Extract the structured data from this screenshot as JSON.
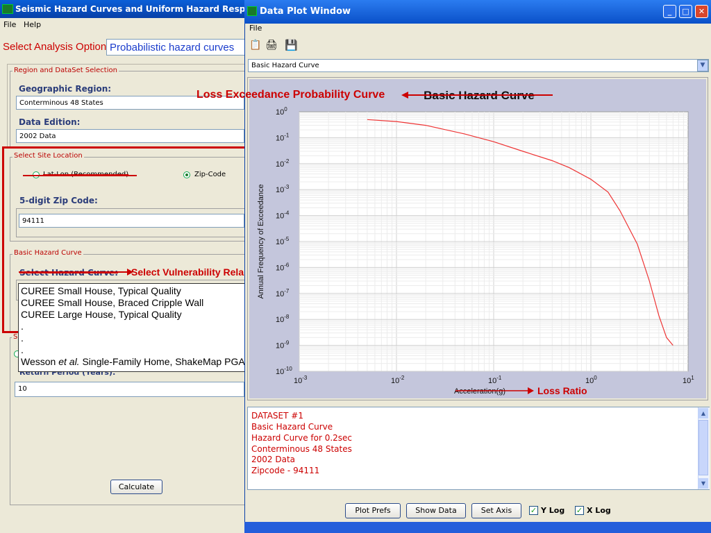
{
  "left_window": {
    "title": "Seismic Hazard Curves and Uniform Hazard Response",
    "menu": [
      "File",
      "Help"
    ],
    "analysis_label": "Select Analysis Option:",
    "analysis_value": "Probabilistic hazard curves",
    "region_group": {
      "title": "Region and DataSet Selection",
      "geo_label": "Geographic Region:",
      "geo_value": "Conterminous 48 States",
      "edition_label": "Data Edition:",
      "edition_value": "2002 Data"
    },
    "site_group": {
      "title": "Select Site Location",
      "latlon_label": "Lat-Lon (Recommended)",
      "zip_option": "Zip-Code",
      "zip_label": "5-digit Zip Code:",
      "zip_value": "94111"
    },
    "hazard_group": {
      "title": "Basic Hazard Curve",
      "select_label": "Select Hazard Curve:",
      "list_items": [
        "CUREE Small House, Typical Quality",
        "CUREE Small House, Braced Cripple Wall",
        "CUREE Large House, Typical Quality",
        ".",
        ".",
        ".",
        "Wesson"
      ],
      "last_item_italic": "et al.",
      "last_item_rest": " Single-Family Home, ShakeMap PGA",
      "s_title": "S",
      "return_label": "Return Period (Years):",
      "return_value": "10"
    },
    "calculate_label": "Calculate"
  },
  "annotations": {
    "vuln": "Select Vulnerability Rela",
    "loss_curve": "Loss Exceedance Probability Curve",
    "loss_ratio": "Loss Ratio"
  },
  "right_window": {
    "title": "Data Plot Window",
    "menu": "File",
    "select_value": "Basic Hazard Curve",
    "info_lines": [
      "DATASET #1",
      "Basic Hazard Curve",
      "Hazard Curve for 0.2sec",
      "Conterminous 48 States",
      "2002 Data",
      "Zipcode - 94111"
    ],
    "buttons": [
      "Plot Prefs",
      "Show Data",
      "Set Axis"
    ],
    "ylog_label": "Y Log",
    "xlog_label": "X Log"
  },
  "chart_data": {
    "type": "line",
    "title": "Basic Hazard Curve",
    "xlabel": "Acceleration(g)",
    "ylabel": "Annual Frequency of Exceedance",
    "x_scale": "log",
    "y_scale": "log",
    "xlim": [
      0.001,
      10
    ],
    "ylim": [
      1e-10,
      1
    ],
    "x_ticks": [
      "10-3",
      "10-2",
      "10-1",
      "100",
      "101"
    ],
    "y_ticks": [
      "100",
      "10-1",
      "10-2",
      "10-3",
      "10-4",
      "10-5",
      "10-6",
      "10-7",
      "10-8",
      "10-9",
      "10-10"
    ],
    "grid": true,
    "color": "#ee3333",
    "series": [
      {
        "x": [
          0.005,
          0.01,
          0.02,
          0.05,
          0.1,
          0.2,
          0.4,
          0.6,
          1.0,
          1.5,
          2.0,
          3.0,
          4.0,
          5.0,
          6.0,
          7.0
        ],
        "y": [
          0.5,
          0.42,
          0.3,
          0.14,
          0.07,
          0.03,
          0.013,
          0.007,
          0.0025,
          0.0008,
          0.00015,
          8e-06,
          3e-07,
          1.4e-08,
          2e-09,
          1e-09
        ]
      }
    ]
  }
}
